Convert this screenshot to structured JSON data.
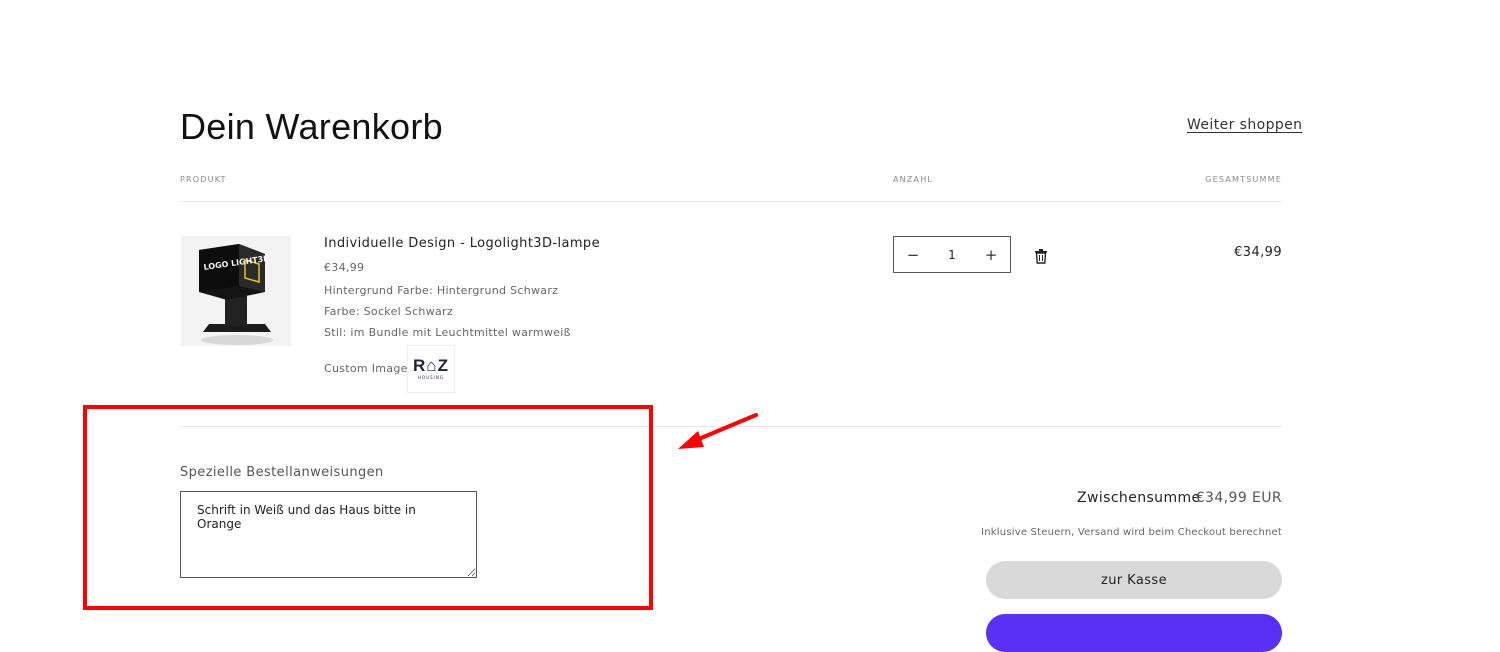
{
  "header": {
    "title": "Dein Warenkorb",
    "continue_label": "Weiter shoppen"
  },
  "columns": {
    "product": "PRODUKT",
    "quantity": "ANZAHL",
    "total": "GESAMTSUMME"
  },
  "cart_item": {
    "name": "Individuelle Design - Logolight3D-lampe",
    "price": "€34,99",
    "options": [
      "Hintergrund Farbe: Hintergrund Schwarz",
      "Farbe: Sockel Schwarz",
      "Stil: im Bundle mit Leuchtmittel warmweiß"
    ],
    "custom_image_label": "Custom Image:",
    "custom_image_logo_text": "R⌂Z",
    "custom_image_logo_sub": "HOUSING",
    "quantity": "1",
    "minus_label": "−",
    "plus_label": "+",
    "line_total": "€34,99",
    "product_image_text": "LOGO LIGHT3D",
    "icons": {
      "remove": "trash-icon"
    }
  },
  "notes": {
    "label": "Spezielle Bestellanweisungen",
    "value": "Schrift in Weiß und das Haus bitte in Orange"
  },
  "summary": {
    "subtotal_label": "Zwischensumme",
    "subtotal_value": "€34,99 EUR",
    "tax_note": "Inklusive Steuern, Versand wird beim Checkout berechnet",
    "checkout_label": "zur Kasse"
  },
  "colors": {
    "annotation": "#ff0000",
    "checkout_bg": "#d9d9d9",
    "shop_pay": "#5a31f4"
  }
}
